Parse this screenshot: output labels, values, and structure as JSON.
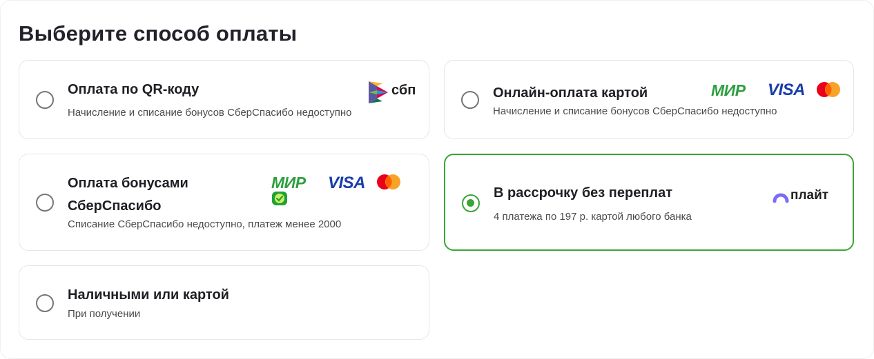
{
  "page": {
    "title": "Выберите способ оплаты"
  },
  "options": {
    "qr": {
      "title": "Оплата по QR-коду",
      "subtitle": "Начисление и списание бонусов СберСпасибо недоступно",
      "logo_text": "сбп",
      "selected": false
    },
    "online_card": {
      "title": "Онлайн-оплата картой",
      "subtitle": "Начисление и списание бонусов СберСпасибо недоступно",
      "mir_text": "МИР",
      "visa_text": "VISA",
      "selected": false
    },
    "bonus": {
      "title_line1": "Оплата бонусами",
      "title_line2": "СберСпасибо",
      "subtitle": "Списание СберСпасибо недоступно, платеж менее 2000",
      "mir_text": "МИР",
      "visa_text": "VISA",
      "selected": false
    },
    "installment": {
      "title": "В рассрочку без переплат",
      "subtitle": "4 платежа по 197 р. картой любого банка",
      "logo_text": "плайт",
      "selected": true
    },
    "cash": {
      "title": "Наличными или картой",
      "subtitle": "При получении",
      "selected": false
    }
  },
  "icons": {
    "sbp": "sbp-logo-icon",
    "mir": "mir-logo-icon",
    "visa": "visa-logo-icon",
    "mastercard": "mastercard-logo-icon",
    "sberspasibo": "sberspasibo-logo-icon",
    "plait": "plait-logo-icon"
  },
  "colors": {
    "accent_green": "#3aa437",
    "mir_green": "#2e9f3f",
    "visa_blue": "#1a3ea8",
    "mastercard_red": "#eb001b",
    "mastercard_orange": "#f79e1b",
    "plait_purple": "#7b6cf6"
  }
}
